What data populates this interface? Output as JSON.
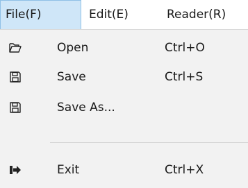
{
  "menubar": {
    "items": [
      {
        "label": "File(F)"
      },
      {
        "label": "Edit(E)"
      },
      {
        "label": "Reader(R)"
      }
    ]
  },
  "file_menu": {
    "items": [
      {
        "label": "Open",
        "shortcut": "Ctrl+O",
        "icon": "folder-open-icon"
      },
      {
        "label": "Save",
        "shortcut": "Ctrl+S",
        "icon": "floppy-disk-icon"
      },
      {
        "label": "Save As...",
        "shortcut": "",
        "icon": "floppy-disk-icon"
      },
      {
        "label": "Exit",
        "shortcut": "Ctrl+X",
        "icon": "exit-icon"
      }
    ]
  },
  "colors": {
    "active_menu_bg": "#cfe6f8",
    "active_menu_border": "#8fc0e6",
    "dropdown_bg": "#f2f2f2",
    "separator": "#d6d6d6"
  }
}
